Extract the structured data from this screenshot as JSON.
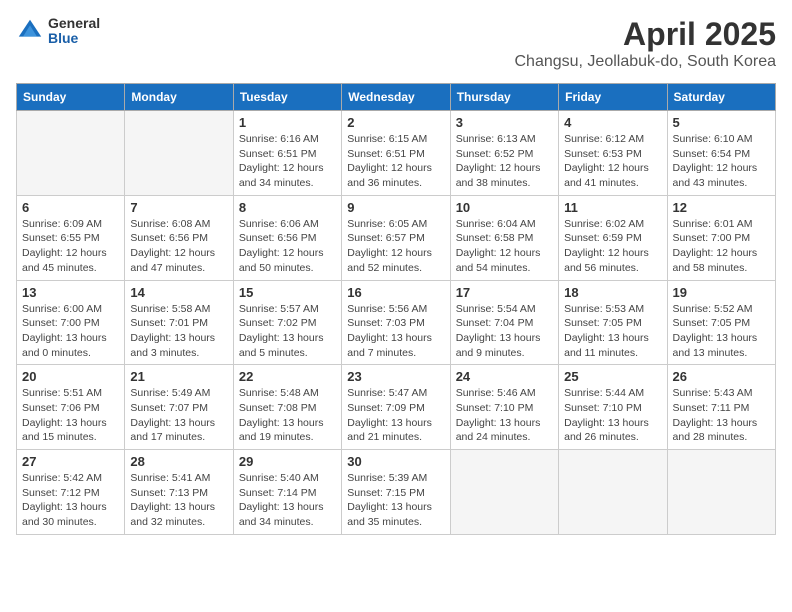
{
  "header": {
    "logo_general": "General",
    "logo_blue": "Blue",
    "title": "April 2025",
    "subtitle": "Changsu, Jeollabuk-do, South Korea"
  },
  "weekdays": [
    "Sunday",
    "Monday",
    "Tuesday",
    "Wednesday",
    "Thursday",
    "Friday",
    "Saturday"
  ],
  "weeks": [
    [
      {
        "day": "",
        "info": ""
      },
      {
        "day": "",
        "info": ""
      },
      {
        "day": "1",
        "info": "Sunrise: 6:16 AM\nSunset: 6:51 PM\nDaylight: 12 hours and 34 minutes."
      },
      {
        "day": "2",
        "info": "Sunrise: 6:15 AM\nSunset: 6:51 PM\nDaylight: 12 hours and 36 minutes."
      },
      {
        "day": "3",
        "info": "Sunrise: 6:13 AM\nSunset: 6:52 PM\nDaylight: 12 hours and 38 minutes."
      },
      {
        "day": "4",
        "info": "Sunrise: 6:12 AM\nSunset: 6:53 PM\nDaylight: 12 hours and 41 minutes."
      },
      {
        "day": "5",
        "info": "Sunrise: 6:10 AM\nSunset: 6:54 PM\nDaylight: 12 hours and 43 minutes."
      }
    ],
    [
      {
        "day": "6",
        "info": "Sunrise: 6:09 AM\nSunset: 6:55 PM\nDaylight: 12 hours and 45 minutes."
      },
      {
        "day": "7",
        "info": "Sunrise: 6:08 AM\nSunset: 6:56 PM\nDaylight: 12 hours and 47 minutes."
      },
      {
        "day": "8",
        "info": "Sunrise: 6:06 AM\nSunset: 6:56 PM\nDaylight: 12 hours and 50 minutes."
      },
      {
        "day": "9",
        "info": "Sunrise: 6:05 AM\nSunset: 6:57 PM\nDaylight: 12 hours and 52 minutes."
      },
      {
        "day": "10",
        "info": "Sunrise: 6:04 AM\nSunset: 6:58 PM\nDaylight: 12 hours and 54 minutes."
      },
      {
        "day": "11",
        "info": "Sunrise: 6:02 AM\nSunset: 6:59 PM\nDaylight: 12 hours and 56 minutes."
      },
      {
        "day": "12",
        "info": "Sunrise: 6:01 AM\nSunset: 7:00 PM\nDaylight: 12 hours and 58 minutes."
      }
    ],
    [
      {
        "day": "13",
        "info": "Sunrise: 6:00 AM\nSunset: 7:00 PM\nDaylight: 13 hours and 0 minutes."
      },
      {
        "day": "14",
        "info": "Sunrise: 5:58 AM\nSunset: 7:01 PM\nDaylight: 13 hours and 3 minutes."
      },
      {
        "day": "15",
        "info": "Sunrise: 5:57 AM\nSunset: 7:02 PM\nDaylight: 13 hours and 5 minutes."
      },
      {
        "day": "16",
        "info": "Sunrise: 5:56 AM\nSunset: 7:03 PM\nDaylight: 13 hours and 7 minutes."
      },
      {
        "day": "17",
        "info": "Sunrise: 5:54 AM\nSunset: 7:04 PM\nDaylight: 13 hours and 9 minutes."
      },
      {
        "day": "18",
        "info": "Sunrise: 5:53 AM\nSunset: 7:05 PM\nDaylight: 13 hours and 11 minutes."
      },
      {
        "day": "19",
        "info": "Sunrise: 5:52 AM\nSunset: 7:05 PM\nDaylight: 13 hours and 13 minutes."
      }
    ],
    [
      {
        "day": "20",
        "info": "Sunrise: 5:51 AM\nSunset: 7:06 PM\nDaylight: 13 hours and 15 minutes."
      },
      {
        "day": "21",
        "info": "Sunrise: 5:49 AM\nSunset: 7:07 PM\nDaylight: 13 hours and 17 minutes."
      },
      {
        "day": "22",
        "info": "Sunrise: 5:48 AM\nSunset: 7:08 PM\nDaylight: 13 hours and 19 minutes."
      },
      {
        "day": "23",
        "info": "Sunrise: 5:47 AM\nSunset: 7:09 PM\nDaylight: 13 hours and 21 minutes."
      },
      {
        "day": "24",
        "info": "Sunrise: 5:46 AM\nSunset: 7:10 PM\nDaylight: 13 hours and 24 minutes."
      },
      {
        "day": "25",
        "info": "Sunrise: 5:44 AM\nSunset: 7:10 PM\nDaylight: 13 hours and 26 minutes."
      },
      {
        "day": "26",
        "info": "Sunrise: 5:43 AM\nSunset: 7:11 PM\nDaylight: 13 hours and 28 minutes."
      }
    ],
    [
      {
        "day": "27",
        "info": "Sunrise: 5:42 AM\nSunset: 7:12 PM\nDaylight: 13 hours and 30 minutes."
      },
      {
        "day": "28",
        "info": "Sunrise: 5:41 AM\nSunset: 7:13 PM\nDaylight: 13 hours and 32 minutes."
      },
      {
        "day": "29",
        "info": "Sunrise: 5:40 AM\nSunset: 7:14 PM\nDaylight: 13 hours and 34 minutes."
      },
      {
        "day": "30",
        "info": "Sunrise: 5:39 AM\nSunset: 7:15 PM\nDaylight: 13 hours and 35 minutes."
      },
      {
        "day": "",
        "info": ""
      },
      {
        "day": "",
        "info": ""
      },
      {
        "day": "",
        "info": ""
      }
    ]
  ]
}
